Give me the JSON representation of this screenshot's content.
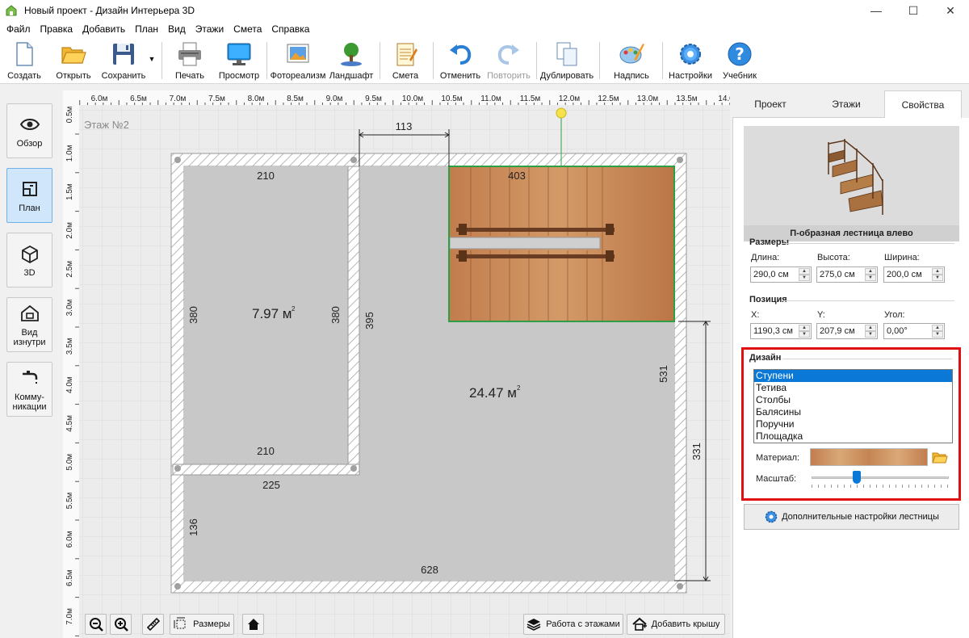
{
  "window": {
    "title": "Новый проект - Дизайн Интерьера 3D",
    "minimize": "—",
    "maximize": "☐",
    "close": "✕"
  },
  "menu": [
    "Файл",
    "Правка",
    "Добавить",
    "План",
    "Вид",
    "Этажи",
    "Смета",
    "Справка"
  ],
  "toolbar": {
    "create": "Создать",
    "open": "Открыть",
    "save": "Сохранить",
    "print": "Печать",
    "preview": "Просмотр",
    "photorealism": "Фотореализм",
    "landscape": "Ландшафт",
    "estimate": "Смета",
    "undo": "Отменить",
    "redo": "Повторить",
    "duplicate": "Дублировать",
    "label": "Надпись",
    "settings": "Настройки",
    "tutorial": "Учебник"
  },
  "sidebar": {
    "overview": "Обзор",
    "plan": "План",
    "view3d": "3D",
    "inside_1": "Вид",
    "inside_2": "изнутри",
    "comm_1": "Комму-",
    "comm_2": "никации"
  },
  "canvas": {
    "floor_label": "Этаж №2",
    "ruler_top": [
      "6.0м",
      "6.5м",
      "7.0м",
      "7.5м",
      "8.0м",
      "8.5м",
      "9.0м",
      "9.5м",
      "10.0м",
      "10.5м",
      "11.0м",
      "11.5м",
      "12.0м",
      "12.5м",
      "13.0м",
      "13.5м",
      "14.0"
    ],
    "ruler_left": [
      "0.5м",
      "1.0м",
      "1.5м",
      "2.0м",
      "2.5м",
      "3.0м",
      "3.5м",
      "4.0м",
      "4.5м",
      "5.0м",
      "5.5м",
      "6.0м",
      "6.5м",
      "7.0м"
    ],
    "dims": {
      "top_gap": "113",
      "room1_top": "210",
      "room1_bottom": "210",
      "room1_left": "380",
      "room1_right": "380",
      "wall_395": "395",
      "stair_top": "403",
      "right_531": "531",
      "right_331": "331",
      "lower_225": "225",
      "left_136": "136",
      "bottom_628": "628"
    },
    "area1": "7.97 м",
    "area2": "24.47 м",
    "area_sup": "2",
    "tools": {
      "dimensions": "Размеры",
      "floors_work": "Работа с этажами",
      "add_roof": "Добавить крышу"
    }
  },
  "panel": {
    "tabs": [
      "Проект",
      "Этажи",
      "Свойства"
    ],
    "active_tab": "Свойства",
    "preview_caption": "П-образная лестница влево",
    "sizes_title": "Размеры",
    "length_label": "Длина:",
    "length_value": "290,0 см",
    "height_label": "Высота:",
    "height_value": "275,0 см",
    "width_label": "Ширина:",
    "width_value": "200,0 см",
    "position_title": "Позиция",
    "x_label": "X:",
    "x_value": "1190,3 см",
    "y_label": "Y:",
    "y_value": "207,9 см",
    "angle_label": "Угол:",
    "angle_value": "0,00°",
    "design_title": "Дизайн",
    "design_items": [
      "Ступени",
      "Тетива",
      "Столбы",
      "Балясины",
      "Поручни",
      "Площадка"
    ],
    "selected_item": "Ступени",
    "material_label": "Материал:",
    "scale_label": "Масштаб:",
    "scale_level": 0.33,
    "advanced_button": "Дополнительные настройки лестницы"
  },
  "colors": {
    "accent": "#0a78d7",
    "highlight_box": "#e01010",
    "stair_outline": "#2ea043",
    "wood": "#c8885a"
  }
}
